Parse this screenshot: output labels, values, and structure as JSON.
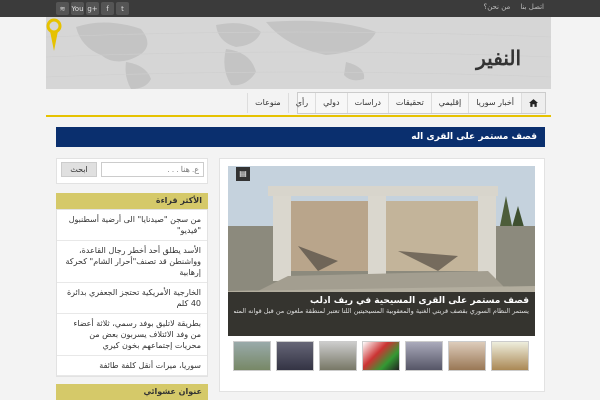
{
  "topbar": {
    "links": [
      "اتصل بنا",
      "من نحن؟"
    ],
    "social": [
      "rss-icon",
      "youtube-icon",
      "googleplus-icon",
      "facebook-icon",
      "twitter-icon"
    ],
    "social_glyphs": [
      "≋",
      "You",
      "g+",
      "f",
      "t"
    ]
  },
  "logo": {
    "text": "النفير"
  },
  "nav": {
    "home_icon": "home-icon",
    "items": [
      "أخبار سوريا",
      "إقليمي",
      "تحقيقات",
      "دراسات",
      "دولي",
      "رأي",
      "منوعات"
    ]
  },
  "ticker": {
    "text": "قصف مستمر على القرى اله"
  },
  "search": {
    "placeholder": "ع. هنا . . .",
    "button": "ابحث"
  },
  "most_read": {
    "title": "الأكثر قراءة",
    "items": [
      "من سجن \"صيدنايا\" الى أرضية أسطنبول \"فيديو\"",
      "الأسد يطلق أحد أخطر رجال القاعدة، وواشنطن قد تصنف\"أحرار الشام\" كحركة إرهابية",
      "الخارجية الأمريكية تحتجز الجعفري بدائرة 40 كلم",
      "بطريقة لاتليق بوفد رسمي، ثلاثة أعضاء من وفد الائتلاف يسربون بعض من محريات إجتماعهم بخون كيري",
      "سوريا، ميرات أنقل كلفة طائفة"
    ]
  },
  "random": {
    "title": "عنوان عشوائي"
  },
  "featured": {
    "title": "قصف مستمر على القرى المسيحية في ريف ادلب",
    "desc": "يستمر النظام السوري بقصف قريتي الغنية والمعقوبية المسيحيتين اللتا تعتبر لمنطقة ملعون من قبل قوانه المتمركزة في معسكر الشعور الوطني من خلال غارات جوية ..."
  },
  "thumbs_count": 7
}
